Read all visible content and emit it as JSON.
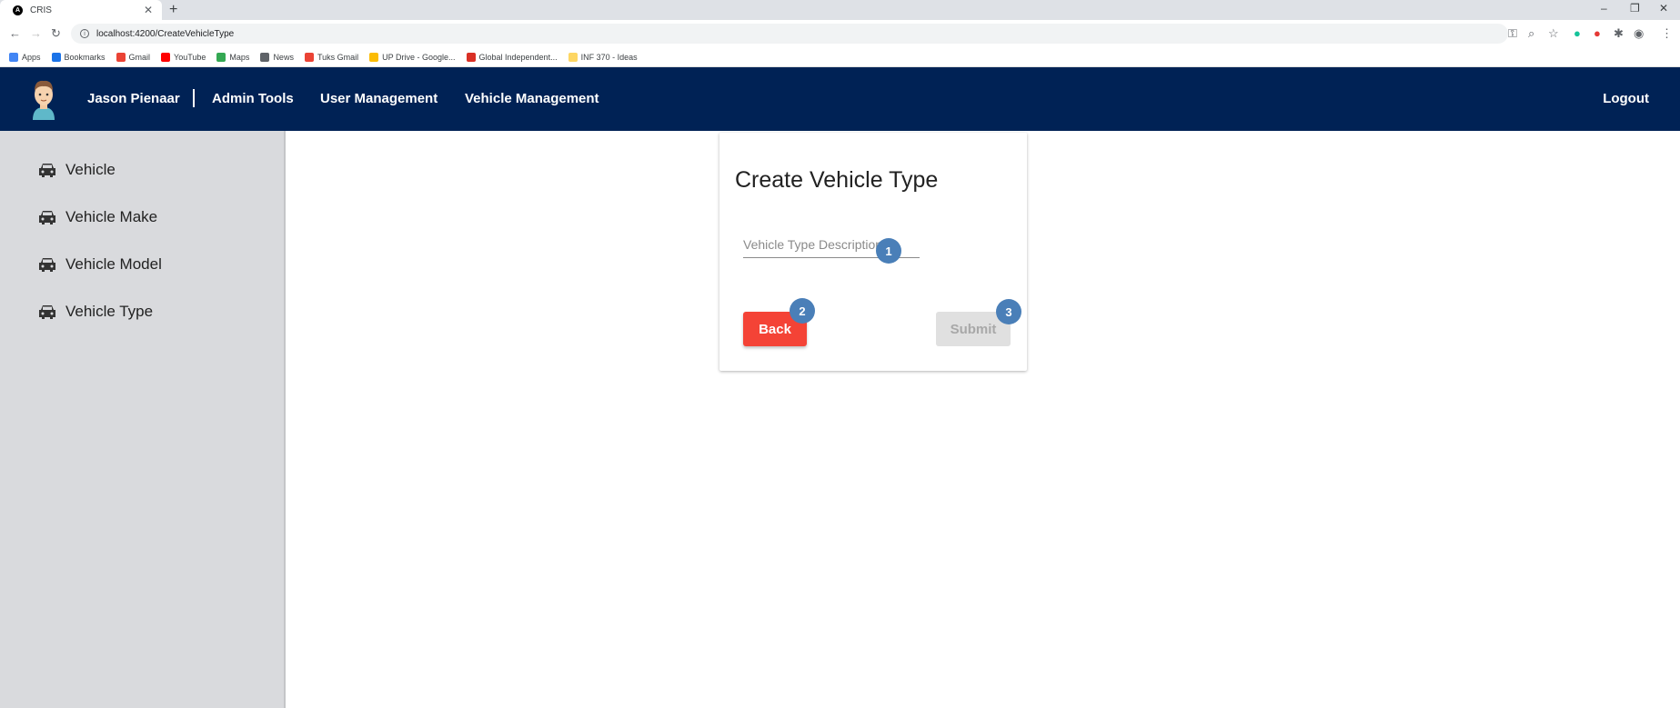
{
  "browser": {
    "tab_title": "CRIS",
    "url": "localhost:4200/CreateVehicleType",
    "bookmarks": [
      {
        "label": "Apps",
        "color": "#4285f4"
      },
      {
        "label": "Bookmarks",
        "color": "#1a73e8"
      },
      {
        "label": "Gmail",
        "color": "#ea4335"
      },
      {
        "label": "YouTube",
        "color": "#ff0000"
      },
      {
        "label": "Maps",
        "color": "#34a853"
      },
      {
        "label": "News",
        "color": "#5f6368"
      },
      {
        "label": "Tuks Gmail",
        "color": "#ea4335"
      },
      {
        "label": "UP Drive - Google...",
        "color": "#fbbc04"
      },
      {
        "label": "Global Independent...",
        "color": "#d93025"
      },
      {
        "label": "INF 370 - Ideas",
        "color": "#fdd663"
      }
    ]
  },
  "header": {
    "user_name": "Jason Pienaar",
    "nav": [
      "Admin Tools",
      "User Management",
      "Vehicle Management"
    ],
    "logout": "Logout",
    "bg_color": "#002255"
  },
  "sidebar": {
    "items": [
      {
        "label": "Vehicle",
        "icon": "car-icon"
      },
      {
        "label": "Vehicle Make",
        "icon": "car-icon"
      },
      {
        "label": "Vehicle Model",
        "icon": "car-icon"
      },
      {
        "label": "Vehicle Type",
        "icon": "car-icon"
      }
    ]
  },
  "form": {
    "title": "Create Vehicle Type",
    "description_placeholder": "Vehicle Type Description",
    "description_value": "",
    "back_label": "Back",
    "submit_label": "Submit",
    "submit_disabled": true
  },
  "markers": [
    "1",
    "2",
    "3"
  ],
  "colors": {
    "back": "#f44336",
    "marker": "#4a7fb8",
    "sidebar": "#d9dadd"
  }
}
